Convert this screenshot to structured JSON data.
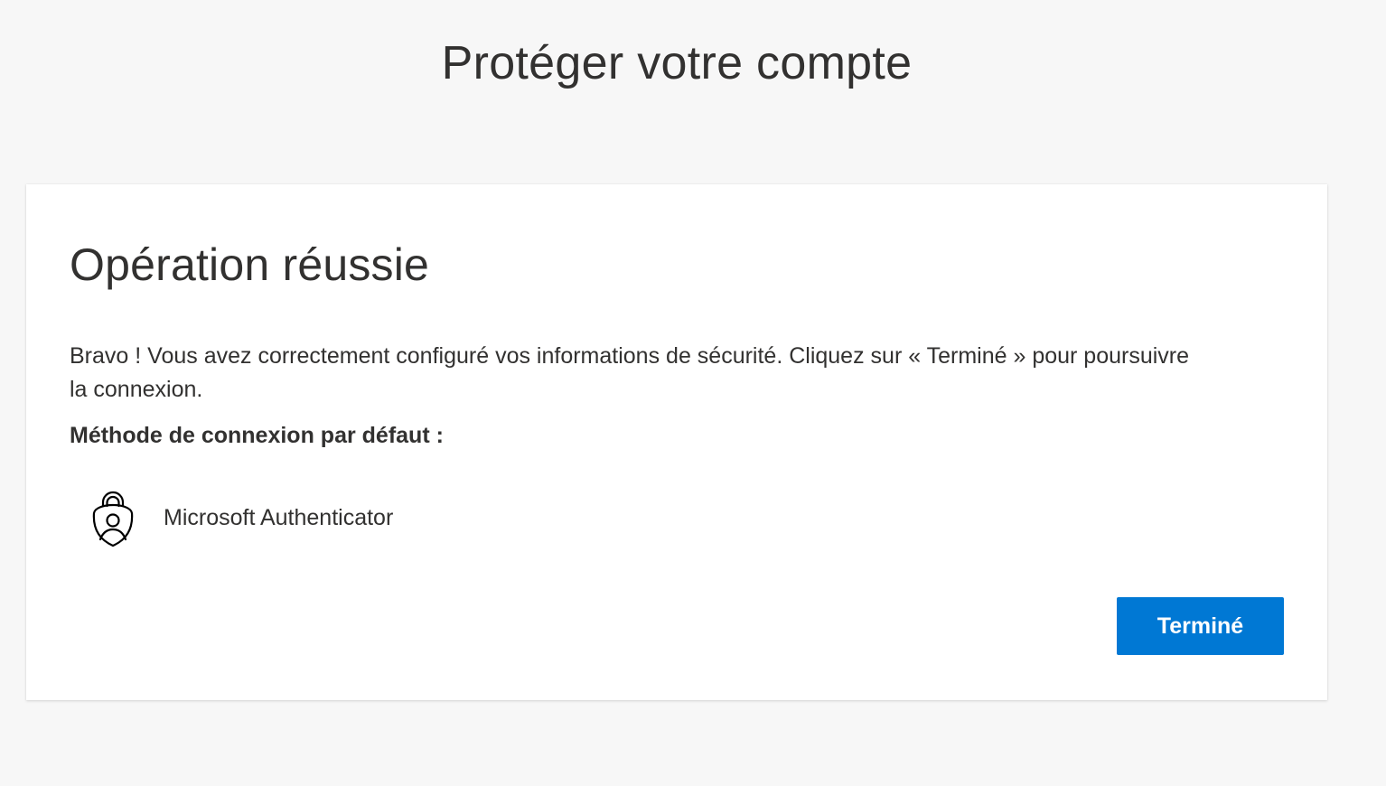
{
  "page": {
    "title": "Protéger votre compte"
  },
  "card": {
    "title": "Opération réussie",
    "description": "Bravo ! Vous avez correctement configuré vos informations de sécurité. Cliquez sur « Terminé » pour poursuivre la connexion.",
    "method_heading": "Méthode de connexion par défaut :",
    "method": {
      "icon": "authenticator-lock-icon",
      "label": "Microsoft Authenticator"
    },
    "done_button_label": "Terminé"
  },
  "colors": {
    "background": "#f7f7f7",
    "card": "#ffffff",
    "text": "#323130",
    "primary_button": "#0078d4",
    "primary_button_text": "#ffffff"
  }
}
